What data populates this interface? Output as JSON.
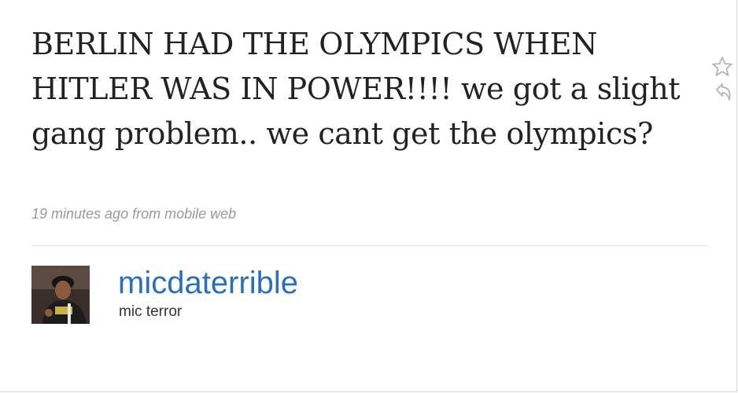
{
  "tweet": {
    "text": "BERLIN HAD THE OLYMPICS WHEN HITLER WAS IN POWER!!!! we got a slight gang problem.. we cant get the olympics?",
    "meta": "19 minutes ago from mobile web"
  },
  "actions": {
    "favorite_icon": "star-outline-icon",
    "reply_icon": "reply-arrow-icon"
  },
  "author": {
    "screen_name": "micdaterrible",
    "full_name": "mic terror",
    "avatar_icon": "profile-photo"
  },
  "colors": {
    "text": "#222222",
    "meta": "#999999",
    "link": "#2a6fb8",
    "divider": "#e6e6e6",
    "icon": "#b5b5b5"
  }
}
